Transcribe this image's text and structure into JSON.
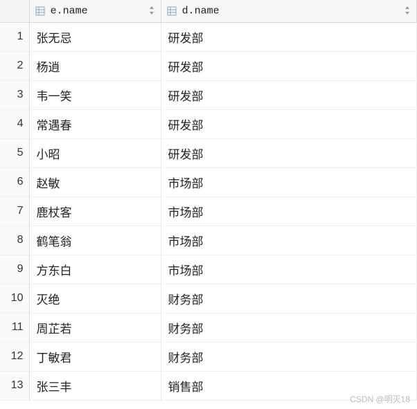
{
  "columns": {
    "e_name": "e.name",
    "d_name": "d.name"
  },
  "rows": [
    {
      "num": "1",
      "e_name": "张无忌",
      "d_name": "研发部"
    },
    {
      "num": "2",
      "e_name": "杨逍",
      "d_name": "研发部"
    },
    {
      "num": "3",
      "e_name": "韦一笑",
      "d_name": "研发部"
    },
    {
      "num": "4",
      "e_name": "常遇春",
      "d_name": "研发部"
    },
    {
      "num": "5",
      "e_name": "小昭",
      "d_name": "研发部"
    },
    {
      "num": "6",
      "e_name": "赵敏",
      "d_name": "市场部"
    },
    {
      "num": "7",
      "e_name": "鹿杖客",
      "d_name": "市场部"
    },
    {
      "num": "8",
      "e_name": "鹤笔翁",
      "d_name": "市场部"
    },
    {
      "num": "9",
      "e_name": "方东白",
      "d_name": "市场部"
    },
    {
      "num": "10",
      "e_name": "灭绝",
      "d_name": "财务部"
    },
    {
      "num": "11",
      "e_name": "周芷若",
      "d_name": "财务部"
    },
    {
      "num": "12",
      "e_name": "丁敏君",
      "d_name": "财务部"
    },
    {
      "num": "13",
      "e_name": "张三丰",
      "d_name": "销售部"
    }
  ],
  "watermark": "CSDN @明灭18"
}
